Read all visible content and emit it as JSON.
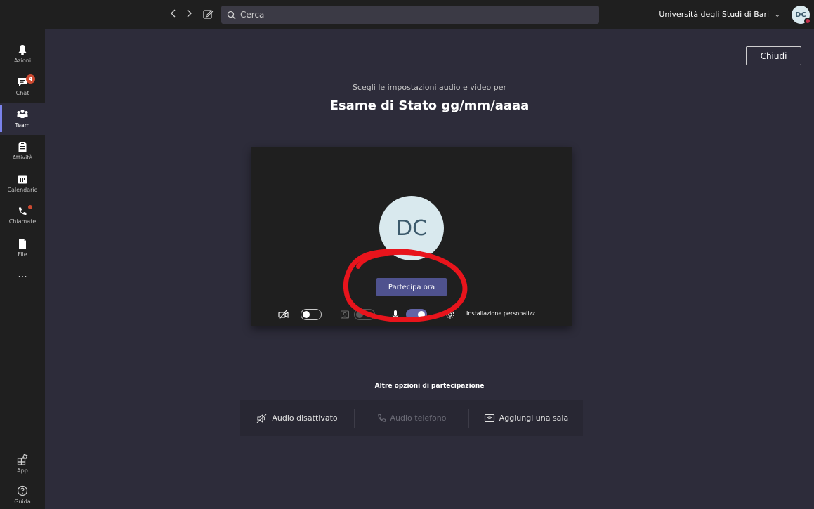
{
  "topbar": {
    "search_placeholder": "Cerca",
    "org_name": "Università degli Studi di Bari",
    "user_initials": "DC"
  },
  "sidebar": {
    "items": [
      {
        "label": "Azioni",
        "icon": "bell-icon"
      },
      {
        "label": "Chat",
        "icon": "chat-icon",
        "badge": "4"
      },
      {
        "label": "Team",
        "icon": "teams-icon",
        "active": true
      },
      {
        "label": "Attività",
        "icon": "assignments-icon"
      },
      {
        "label": "Calendario",
        "icon": "calendar-icon"
      },
      {
        "label": "Chiamate",
        "icon": "phone-icon"
      },
      {
        "label": "File",
        "icon": "file-icon"
      },
      {
        "label": "...",
        "icon": "more-icon"
      }
    ],
    "bottom_items": [
      {
        "label": "App",
        "icon": "apps-icon"
      },
      {
        "label": "Guida",
        "icon": "help-icon"
      }
    ]
  },
  "main": {
    "close_label": "Chiudi",
    "subtitle": "Scegli le impostazioni audio e video per",
    "meeting_title": "Esame di Stato gg/mm/aaaa"
  },
  "preview": {
    "avatar_initials": "DC",
    "join_label": "Partecipa ora",
    "custom_setup_label": "Installazione personalizz..."
  },
  "other_options": {
    "heading": "Altre opzioni di partecipazione",
    "audio_off_label": "Audio disattivato",
    "phone_audio_label": "Audio telefono",
    "add_room_label": "Aggiungi una sala"
  },
  "colors": {
    "background": "#2d2c3a",
    "rail": "#1f1f1f",
    "accent": "#6264a7",
    "badge": "#cc4a31",
    "annotation": "#e8141c"
  }
}
